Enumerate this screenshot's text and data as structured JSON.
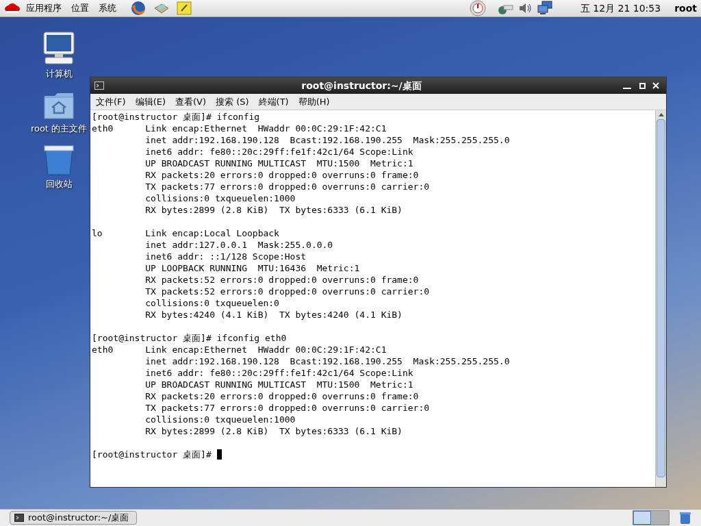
{
  "top_panel": {
    "menus": [
      "应用程序",
      "位置",
      "系统"
    ],
    "clock": "五 12月 21 10:53",
    "user": "root"
  },
  "desktop_icons": [
    {
      "kind": "computer",
      "label": "计算机"
    },
    {
      "kind": "home",
      "label": "root 的主文件"
    },
    {
      "kind": "trash",
      "label": "回收站"
    }
  ],
  "terminal": {
    "title": "root@instructor:~/桌面",
    "menu": [
      "文件(F)",
      "编辑(E)",
      "查看(V)",
      "搜索 (S)",
      "終端(T)",
      "帮助(H)"
    ],
    "blocks": [
      [
        "[root@instructor 桌面]# ifconfig",
        "eth0      Link encap:Ethernet  HWaddr 00:0C:29:1F:42:C1  ",
        "          inet addr:192.168.190.128  Bcast:192.168.190.255  Mask:255.255.255.0",
        "          inet6 addr: fe80::20c:29ff:fe1f:42c1/64 Scope:Link",
        "          UP BROADCAST RUNNING MULTICAST  MTU:1500  Metric:1",
        "          RX packets:20 errors:0 dropped:0 overruns:0 frame:0",
        "          TX packets:77 errors:0 dropped:0 overruns:0 carrier:0",
        "          collisions:0 txqueuelen:1000 ",
        "          RX bytes:2899 (2.8 KiB)  TX bytes:6333 (6.1 KiB)"
      ],
      [
        "lo        Link encap:Local Loopback  ",
        "          inet addr:127.0.0.1  Mask:255.0.0.0",
        "          inet6 addr: ::1/128 Scope:Host",
        "          UP LOOPBACK RUNNING  MTU:16436  Metric:1",
        "          RX packets:52 errors:0 dropped:0 overruns:0 frame:0",
        "          TX packets:52 errors:0 dropped:0 overruns:0 carrier:0",
        "          collisions:0 txqueuelen:0 ",
        "          RX bytes:4240 (4.1 KiB)  TX bytes:4240 (4.1 KiB)"
      ],
      [
        "[root@instructor 桌面]# ifconfig eth0",
        "eth0      Link encap:Ethernet  HWaddr 00:0C:29:1F:42:C1  ",
        "          inet addr:192.168.190.128  Bcast:192.168.190.255  Mask:255.255.255.0",
        "          inet6 addr: fe80::20c:29ff:fe1f:42c1/64 Scope:Link",
        "          UP BROADCAST RUNNING MULTICAST  MTU:1500  Metric:1",
        "          RX packets:20 errors:0 dropped:0 overruns:0 frame:0",
        "          TX packets:77 errors:0 dropped:0 overruns:0 carrier:0",
        "          collisions:0 txqueuelen:1000 ",
        "          RX bytes:2899 (2.8 KiB)  TX bytes:6333 (6.1 KiB)"
      ],
      [
        "[root@instructor 桌面]# "
      ]
    ],
    "cursor_visible": true
  },
  "taskbar": {
    "tasks": [
      {
        "label": "root@instructor:~/桌面",
        "selected": false
      }
    ],
    "workspaces": [
      {
        "selected": true
      },
      {
        "selected": false
      }
    ]
  }
}
